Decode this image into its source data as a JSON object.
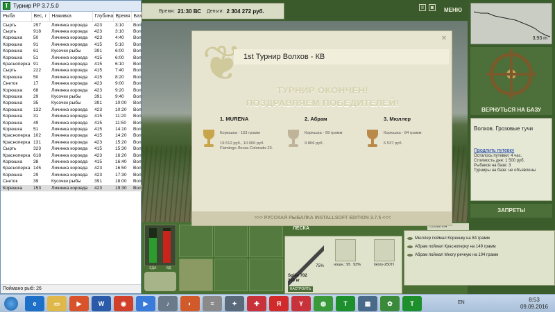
{
  "log_window": {
    "title": "Турнир РР 3.7.5.0",
    "app_icon": "Т",
    "columns": [
      "Рыба",
      "Вес, г",
      "Наживка",
      "Глубина",
      "Время",
      "База"
    ],
    "rows": [
      [
        "Сырть",
        "297",
        "Личинка короеда",
        "423",
        "3:10",
        "Вол"
      ],
      [
        "Сырть",
        "918",
        "Личинка короеда",
        "423",
        "3:10",
        "Вол"
      ],
      [
        "Корюшка",
        "50",
        "Личинка короеда",
        "423",
        "4:40",
        "Вол"
      ],
      [
        "Корюшка",
        "91",
        "Личинка короеда",
        "415",
        "5:10",
        "Вол"
      ],
      [
        "Корюшка",
        "61",
        "Кусочки рыбы",
        "391",
        "6:00",
        "Вол"
      ],
      [
        "Корюшка",
        "51",
        "Личинка короеда",
        "415",
        "6:00",
        "Вол"
      ],
      [
        "Красноперка",
        "91",
        "Личинка короеда",
        "415",
        "6:10",
        "Вол"
      ],
      [
        "Сырть",
        "222",
        "Личинка короеда",
        "415",
        "7:40",
        "Вол"
      ],
      [
        "Корюшка",
        "50",
        "Личинка короеда",
        "415",
        "8:20",
        "Вол"
      ],
      [
        "Снеток",
        "17",
        "Личинка короеда",
        "423",
        "9:00",
        "Вол"
      ],
      [
        "Корюшка",
        "68",
        "Личинка короеда",
        "423",
        "9:20",
        "Вол"
      ],
      [
        "Корюшка",
        "29",
        "Кусочки рыбы",
        "391",
        "9:40",
        "Вол"
      ],
      [
        "Корюшка",
        "35",
        "Кусочки рыбы",
        "391",
        "10:00",
        "Вол"
      ],
      [
        "Корюшка",
        "132",
        "Личинка короеда",
        "423",
        "10:20",
        "Вол"
      ],
      [
        "Корюшка",
        "31",
        "Личинка короеда",
        "415",
        "11:20",
        "Вол"
      ],
      [
        "Корюшка",
        "49",
        "Личинка короеда",
        "415",
        "11:50",
        "Вол"
      ],
      [
        "Корюшка",
        "51",
        "Личинка короеда",
        "415",
        "14:10",
        "Вол"
      ],
      [
        "Красноперка",
        "102",
        "Личинка короеда",
        "415",
        "14:20",
        "Вол"
      ],
      [
        "Красноперка",
        "131",
        "Личинка короеда",
        "423",
        "15:20",
        "Вол"
      ],
      [
        "Сырть",
        "323",
        "Личинка короеда",
        "415",
        "15:30",
        "Вол"
      ],
      [
        "Красноперка",
        "618",
        "Личинка короеда",
        "423",
        "16:20",
        "Вол"
      ],
      [
        "Корюшка",
        "38",
        "Личинка короеда",
        "415",
        "16:40",
        "Вол"
      ],
      [
        "Красноперка",
        "145",
        "Личинка короеда",
        "423",
        "16:50",
        "Вол"
      ],
      [
        "Корюшка",
        "29",
        "Личинка короеда",
        "423",
        "17:30",
        "Вол"
      ],
      [
        "Снеток",
        "39",
        "Кусочки рыбы",
        "391",
        "18:00",
        "Вол"
      ],
      [
        "Корюшка",
        "153",
        "Личинка короеда",
        "423",
        "19:30",
        "Вол"
      ]
    ],
    "status": "Поймано рыб: 26"
  },
  "game": {
    "time_label": "Время:",
    "time_value": "21:30 ВС",
    "money_label": "Деньги:",
    "money_value": "2 304 272 руб.",
    "menu_label": "МЕНЮ",
    "depth": "3,93 m",
    "return_base": "ВЕРНУТЬСЯ НА БАЗУ",
    "location": "Волхов. Грозовые тучи",
    "extend_trip": "Продлить путевку",
    "info_lines": [
      "Осталось путевки: 4 час.",
      "Стоимость дня: 1 500 руб.",
      "Рыбаков на базе: 3",
      "Турниры на базе: не объявлены"
    ],
    "bans": "ЗАПРЕТЫ",
    "tackle_label": "ЛЕСКА",
    "rod_name": "Spike 702",
    "rod_weight": "300 кг",
    "setup_button": "НАСТРОИТЬ",
    "rod_percent": "75%",
    "slot_labels": [
      "ношн.: 95",
      "93%",
      "Glory-250TI"
    ],
    "events_tab": "СОБЫТИЯ",
    "events": [
      "Мюллер поймал Корюшку на 84 грамм",
      "Абрам поймал Красноперку на 149 грамм",
      "Абрам поймал Многу речную на 104 грамм"
    ],
    "gauge_left": "ЕДА",
    "gauge_right": "ВД"
  },
  "modal": {
    "title": "1st Турнир Волхов - КВ",
    "over": "ТУРНИР ОКОНЧЕН!",
    "congrats": "ПОЗДРАВЛЯЕМ ПОБЕДИТЕЛЕЙ!",
    "places": [
      {
        "name": "1. MURENA",
        "fish": "Корюшка - 153 грамм",
        "prize": "19 612 руб., 10 000 руб.",
        "extra": "Flamingo Леска Colorado-23.",
        "cup_color": "#c8a44a"
      },
      {
        "name": "2. Абрам",
        "fish": "Корюшка - 99 грамм",
        "prize": "9 806 руб.",
        "extra": "",
        "cup_color": "#bfb49a"
      },
      {
        "name": "3. Мюллер",
        "fish": "Корюшка - 84 грамм",
        "prize": "6 537 руб.",
        "extra": "",
        "cup_color": "#b98a4a"
      }
    ],
    "footer": ">>> РУССКАЯ РЫБАЛКА INSTALLSOFT EDITION 3.7.5 <<<"
  },
  "taskbar": {
    "lang": "EN",
    "time": "8:53",
    "date": "09.09.2016"
  }
}
